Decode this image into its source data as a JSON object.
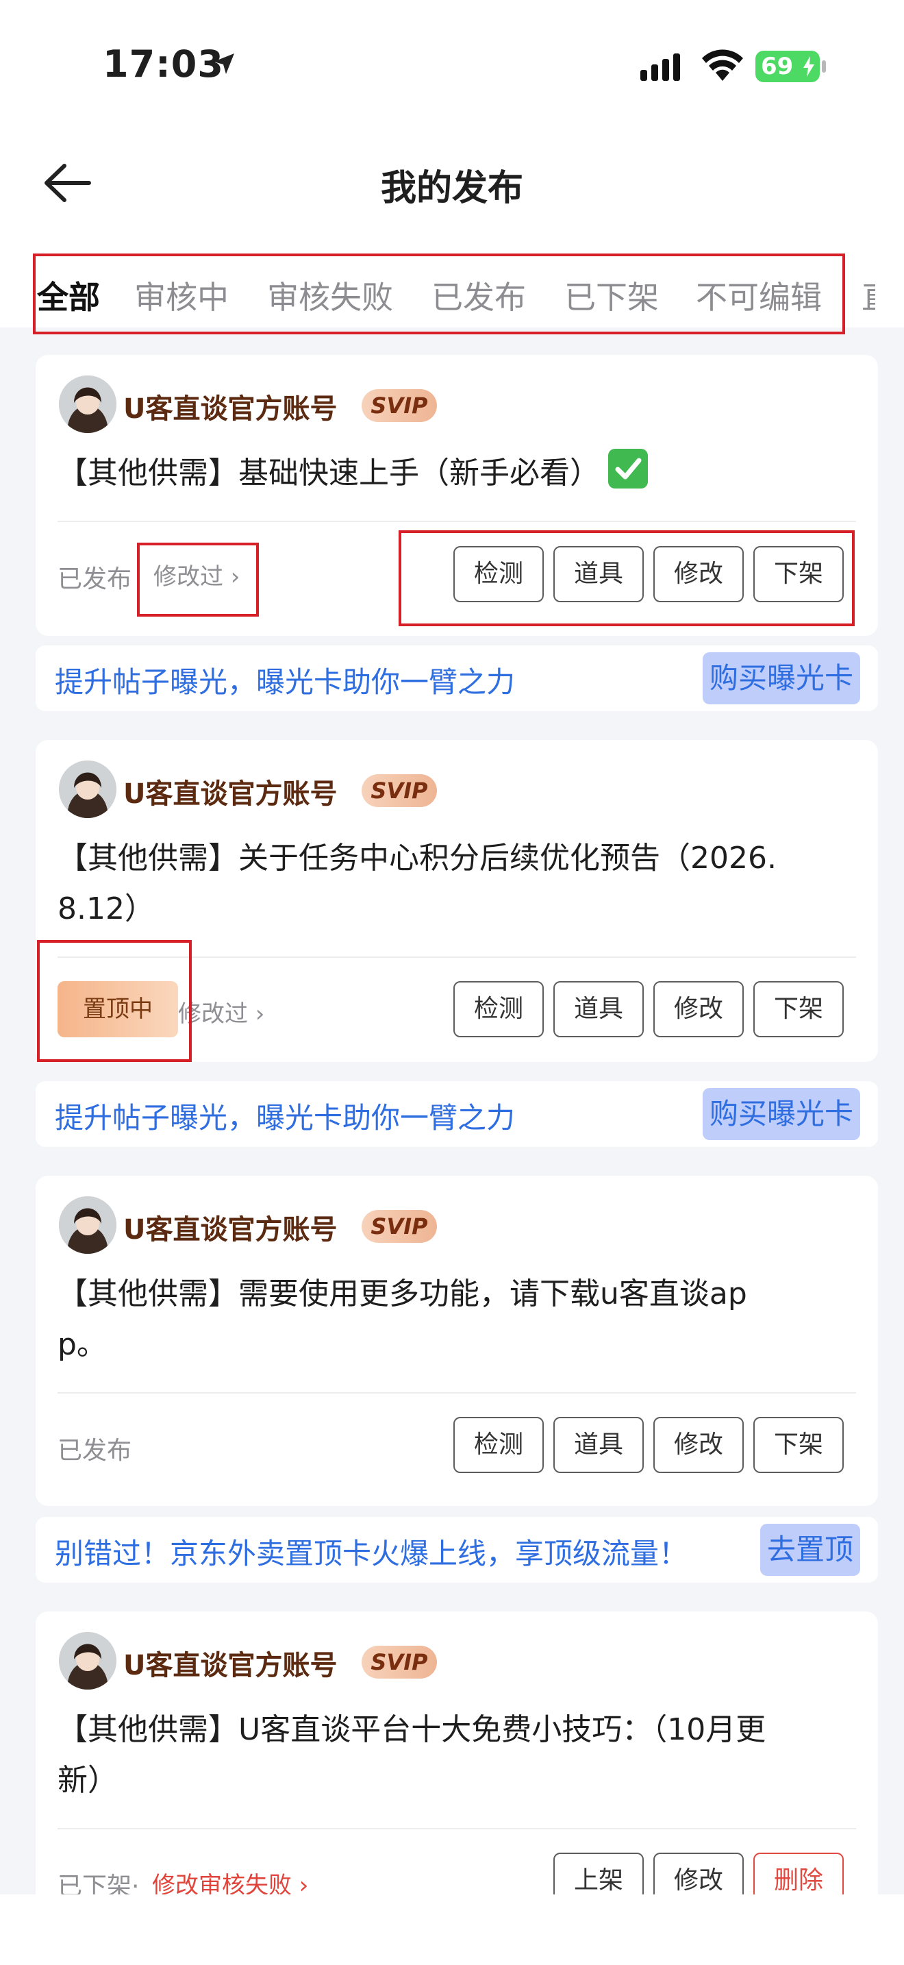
{
  "status_bar": {
    "time": "17:03",
    "battery": "69",
    "icons": [
      "location-arrow-icon",
      "cellular-signal-icon",
      "wifi-icon",
      "battery-icon"
    ]
  },
  "header": {
    "title": "我的发布",
    "back_icon": "back-arrow-icon"
  },
  "tabs": [
    {
      "label": "全部",
      "active": true
    },
    {
      "label": "审核中",
      "active": false
    },
    {
      "label": "审核失败",
      "active": false
    },
    {
      "label": "已发布",
      "active": false
    },
    {
      "label": "已下架",
      "active": false
    },
    {
      "label": "不可编辑",
      "active": false
    },
    {
      "label": "直",
      "active": false
    }
  ],
  "posts": [
    {
      "username": "U客直谈官方账号",
      "badge": "SVIP",
      "title": "【其他供需】基础快速上手（新手必看）",
      "title_icon": "check-mark-icon",
      "status": "已发布",
      "modified": "修改过 ›",
      "actions": [
        "检测",
        "道具",
        "修改",
        "下架"
      ]
    },
    {
      "username": "U客直谈官方账号",
      "badge": "SVIP",
      "title_line1": "【其他供需】关于任务中心积分后续优化预告（2026.",
      "title_line2": "8.12）",
      "pinned": "置顶中",
      "modified": "修改过 ›",
      "actions": [
        "检测",
        "道具",
        "修改",
        "下架"
      ]
    },
    {
      "username": "U客直谈官方账号",
      "badge": "SVIP",
      "title_line1": "【其他供需】需要使用更多功能，请下载u客直谈ap",
      "title_line2": "p。",
      "status": "已发布",
      "actions": [
        "检测",
        "道具",
        "修改",
        "下架"
      ]
    },
    {
      "username": "U客直谈官方账号",
      "badge": "SVIP",
      "title_line1": "【其他供需】U客直谈平台十大免费小技巧：（10月更",
      "title_line2": "新）",
      "status": "已下架·",
      "modified_fail": "修改审核失败 ›",
      "actions": [
        "上架",
        "修改",
        "删除"
      ]
    }
  ],
  "promos": [
    {
      "text": "提升帖子曝光，曝光卡助你一臂之力",
      "button": "购买曝光卡"
    },
    {
      "text": "提升帖子曝光，曝光卡助你一臂之力",
      "button": "购买曝光卡"
    },
    {
      "text": "别错过！京东外卖置顶卡火爆上线，享顶级流量！",
      "button": "去置顶"
    }
  ],
  "colors": {
    "highlight_box": "#d61f26",
    "promo_text": "#2f6ee0",
    "promo_button_bg": "#bfcdfb",
    "danger": "#e04a41"
  }
}
